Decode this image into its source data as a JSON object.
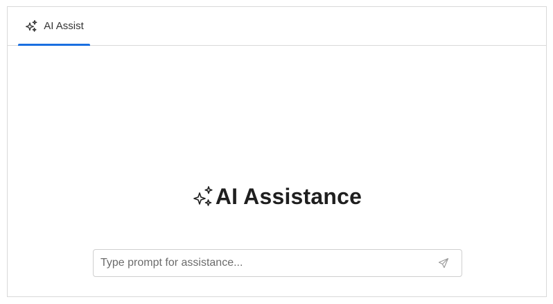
{
  "tabs": [
    {
      "label": "AI Assist",
      "icon": "sparkles-icon",
      "active": true
    }
  ],
  "main": {
    "title": "AI Assistance",
    "title_icon": "sparkles-icon"
  },
  "prompt": {
    "placeholder": "Type prompt for assistance...",
    "value": "",
    "send_icon": "send-icon"
  },
  "colors": {
    "accent": "#1a6fe0",
    "border": "#d9d9d9",
    "text": "#1f1f1f",
    "placeholder": "#6b6b6b"
  }
}
